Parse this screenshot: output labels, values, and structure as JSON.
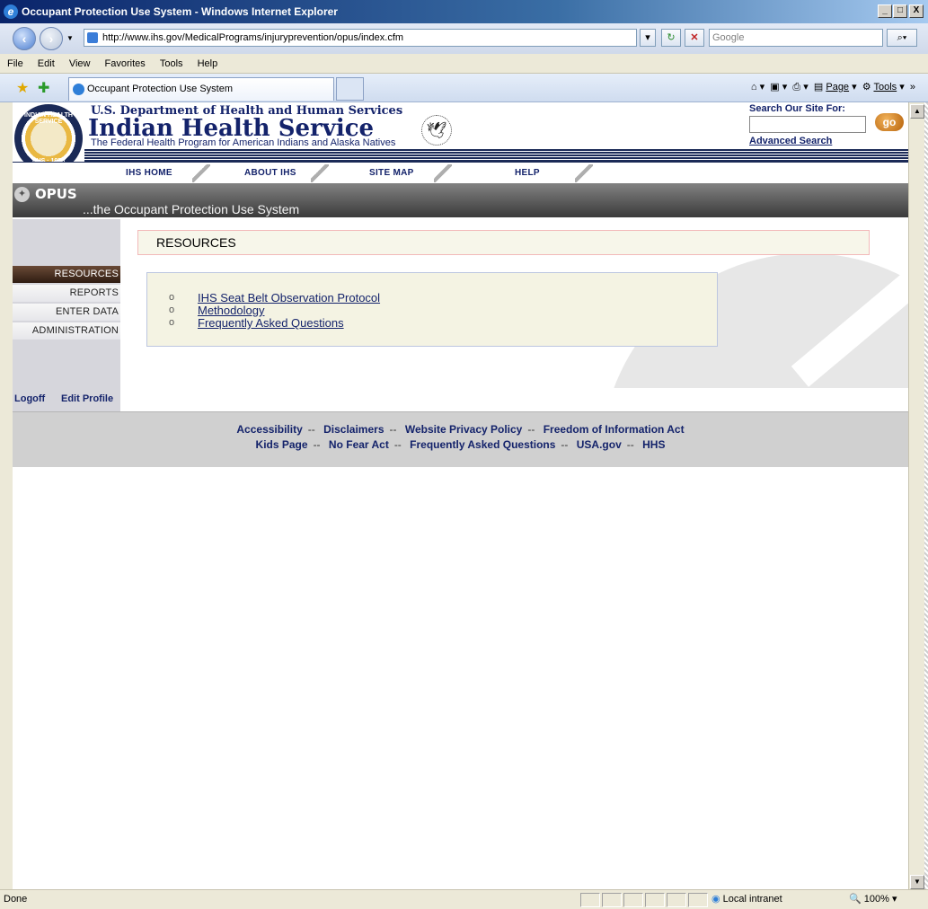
{
  "window": {
    "title": "Occupant Protection Use System - Windows Internet Explorer",
    "min": "_",
    "max": "□",
    "close": "X"
  },
  "address": {
    "url": "http://www.ihs.gov/MedicalPrograms/injuryprevention/opus/index.cfm",
    "search_placeholder": "Google"
  },
  "menu": [
    "File",
    "Edit",
    "View",
    "Favorites",
    "Tools",
    "Help"
  ],
  "tab": {
    "label": "Occupant Protection Use System"
  },
  "toolbar": {
    "page": "Page",
    "tools": "Tools"
  },
  "header": {
    "dept": "U.S. Department of Health and Human Services",
    "agency": "Indian Health Service",
    "tagline": "The Federal Health Program for American Indians and Alaska Natives",
    "seal_top": "INDIAN HEALTH SERVICE",
    "seal_bottom": "PHS · 1955",
    "search_label": "Search Our Site For:",
    "go": "go",
    "advanced": "Advanced Search"
  },
  "topnav": [
    "IHS HOME",
    "ABOUT IHS",
    "SITE MAP",
    "HELP"
  ],
  "opus": {
    "title": "OPUS",
    "subtitle": "...the Occupant Protection Use System"
  },
  "leftnav": {
    "items": [
      "RESOURCES",
      "REPORTS",
      "ENTER DATA",
      "ADMINISTRATION"
    ],
    "active": "RESOURCES",
    "logoff": "Logoff",
    "edit_profile": "Edit Profile"
  },
  "main": {
    "title": "RESOURCES",
    "links": [
      "IHS Seat Belt Observation Protocol",
      "Methodology",
      "Frequently Asked Questions"
    ]
  },
  "footer": {
    "row1": [
      "Accessibility",
      "Disclaimers",
      "Website Privacy Policy",
      "Freedom of Information Act"
    ],
    "row2": [
      "Kids Page",
      "No Fear Act",
      "Frequently Asked Questions",
      "USA.gov",
      "HHS"
    ],
    "sep": "--"
  },
  "status": {
    "text": "Done",
    "zone": "Local intranet",
    "zoom": "100%"
  }
}
